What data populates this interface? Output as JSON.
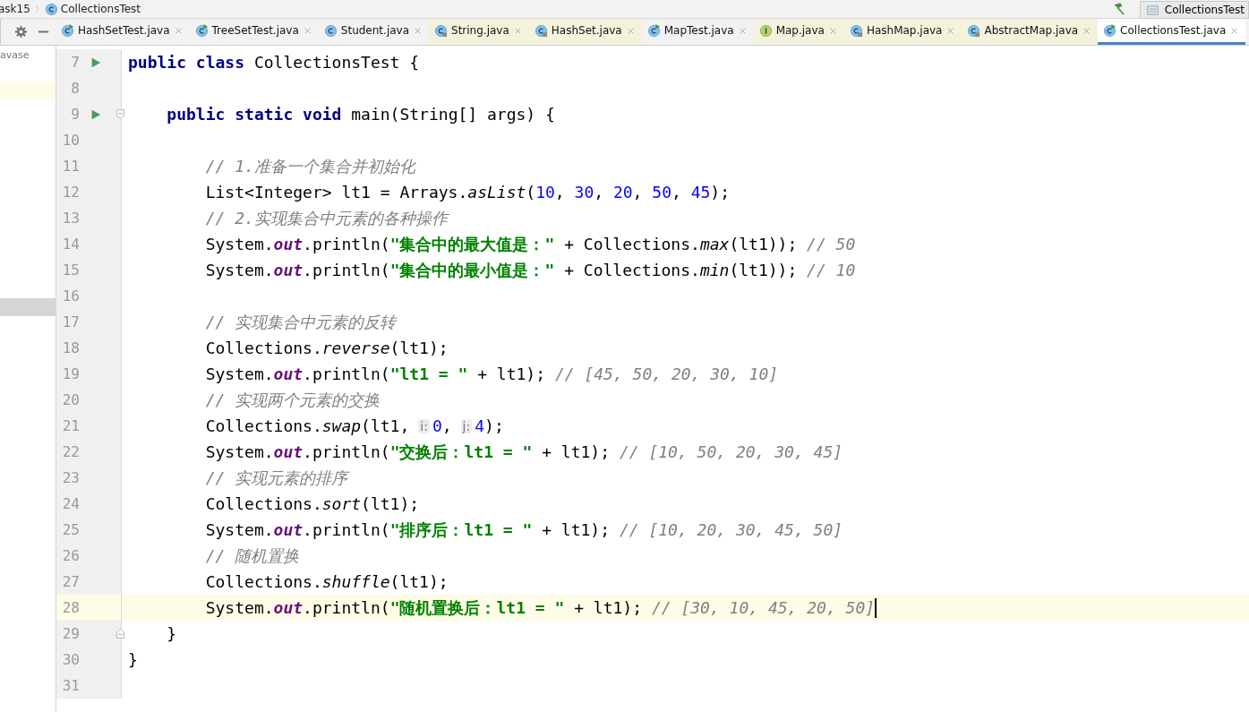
{
  "breadcrumb": [
    {
      "text": "ask15"
    },
    {
      "text": "CollectionsTest",
      "kind": "class"
    }
  ],
  "run_config": {
    "label": "CollectionsTest"
  },
  "project_panel": {
    "label": "avase",
    "rows": [
      {
        "kind": "highlight"
      },
      {
        "kind": "selected"
      }
    ]
  },
  "tabs": [
    {
      "label": "HashSetTest.java",
      "kind": "class-run",
      "readonly": false,
      "selected": false
    },
    {
      "label": "TreeSetTest.java",
      "kind": "class-run",
      "readonly": false,
      "selected": false
    },
    {
      "label": "Student.java",
      "kind": "class",
      "readonly": false,
      "selected": false
    },
    {
      "label": "String.java",
      "kind": "class-locked",
      "readonly": true,
      "selected": false
    },
    {
      "label": "HashSet.java",
      "kind": "class-locked",
      "readonly": true,
      "selected": false
    },
    {
      "label": "MapTest.java",
      "kind": "class-run",
      "readonly": false,
      "selected": false
    },
    {
      "label": "Map.java",
      "kind": "interface",
      "readonly": true,
      "selected": false
    },
    {
      "label": "HashMap.java",
      "kind": "class-locked",
      "readonly": true,
      "selected": false
    },
    {
      "label": "AbstractMap.java",
      "kind": "class-locked",
      "readonly": true,
      "selected": false
    },
    {
      "label": "CollectionsTest.java",
      "kind": "class-run",
      "readonly": false,
      "selected": true
    }
  ],
  "editor": {
    "lines": [
      {
        "number": "7",
        "run": true,
        "kind": "plain",
        "current": false,
        "tokens": [
          {
            "kind": "kw",
            "text": "public class"
          },
          {
            "kind": "plain",
            "text": " CollectionsTest {"
          }
        ]
      },
      {
        "number": "8",
        "run": false,
        "kind": "plain",
        "current": false
      },
      {
        "number": "9",
        "run": true,
        "kind": "fold-start",
        "current": false,
        "tokens": [
          {
            "kind": "kw",
            "text": "    public static void"
          },
          {
            "kind": "plain",
            "text": " main(String[] args) {"
          }
        ]
      },
      {
        "number": "10",
        "run": false,
        "kind": "plain",
        "current": false
      },
      {
        "number": "11",
        "run": false,
        "kind": "plain",
        "current": false,
        "tokens": [
          {
            "kind": "comment",
            "text": "        // 1.准备一个集合并初始化"
          }
        ]
      },
      {
        "number": "12",
        "run": false,
        "kind": "plain",
        "current": false,
        "tokens": [
          {
            "kind": "plain",
            "text": "        List<Integer> lt1 = Arrays."
          },
          {
            "kind": "method",
            "text": "asList"
          },
          {
            "kind": "plain",
            "text": "("
          },
          {
            "kind": "num",
            "text": "10"
          },
          {
            "kind": "plain",
            "text": ", "
          },
          {
            "kind": "num",
            "text": "30"
          },
          {
            "kind": "plain",
            "text": ", "
          },
          {
            "kind": "num",
            "text": "20"
          },
          {
            "kind": "plain",
            "text": ", "
          },
          {
            "kind": "num",
            "text": "50"
          },
          {
            "kind": "plain",
            "text": ", "
          },
          {
            "kind": "num",
            "text": "45"
          },
          {
            "kind": "plain",
            "text": ");"
          }
        ]
      },
      {
        "number": "13",
        "run": false,
        "kind": "plain",
        "current": false,
        "tokens": [
          {
            "kind": "comment",
            "text": "        // 2.实现集合中元素的各种操作"
          }
        ]
      },
      {
        "number": "14",
        "run": false,
        "kind": "plain",
        "current": false,
        "tokens": [
          {
            "kind": "plain",
            "text": "        System."
          },
          {
            "kind": "static",
            "text": "out"
          },
          {
            "kind": "plain",
            "text": ".println("
          },
          {
            "kind": "str",
            "text": "\"集合中的最大值是：\""
          },
          {
            "kind": "plain",
            "text": " + Collections."
          },
          {
            "kind": "method",
            "text": "max"
          },
          {
            "kind": "plain",
            "text": "(lt1)); "
          },
          {
            "kind": "comment",
            "text": "// 50"
          }
        ]
      },
      {
        "number": "15",
        "run": false,
        "kind": "plain",
        "current": false,
        "tokens": [
          {
            "kind": "plain",
            "text": "        System."
          },
          {
            "kind": "static",
            "text": "out"
          },
          {
            "kind": "plain",
            "text": ".println("
          },
          {
            "kind": "str",
            "text": "\"集合中的最小值是：\""
          },
          {
            "kind": "plain",
            "text": " + Collections."
          },
          {
            "kind": "method",
            "text": "min"
          },
          {
            "kind": "plain",
            "text": "(lt1)); "
          },
          {
            "kind": "comment",
            "text": "// 10"
          }
        ]
      },
      {
        "number": "16",
        "run": false,
        "kind": "plain",
        "current": false
      },
      {
        "number": "17",
        "run": false,
        "kind": "plain",
        "current": false,
        "tokens": [
          {
            "kind": "comment",
            "text": "        // 实现集合中元素的反转"
          }
        ]
      },
      {
        "number": "18",
        "run": false,
        "kind": "plain",
        "current": false,
        "tokens": [
          {
            "kind": "plain",
            "text": "        Collections."
          },
          {
            "kind": "method",
            "text": "reverse"
          },
          {
            "kind": "plain",
            "text": "(lt1);"
          }
        ]
      },
      {
        "number": "19",
        "run": false,
        "kind": "plain",
        "current": false,
        "tokens": [
          {
            "kind": "plain",
            "text": "        System."
          },
          {
            "kind": "static",
            "text": "out"
          },
          {
            "kind": "plain",
            "text": ".println("
          },
          {
            "kind": "str",
            "text": "\"lt1 = \""
          },
          {
            "kind": "plain",
            "text": " + lt1); "
          },
          {
            "kind": "comment",
            "text": "// [45, 50, 20, 30, 10]"
          }
        ]
      },
      {
        "number": "20",
        "run": false,
        "kind": "plain",
        "current": false,
        "tokens": [
          {
            "kind": "comment",
            "text": "        // 实现两个元素的交换"
          }
        ]
      },
      {
        "number": "21",
        "run": false,
        "kind": "plain",
        "current": false,
        "tokens": [
          {
            "kind": "plain",
            "text": "        Collections."
          },
          {
            "kind": "method",
            "text": "swap"
          },
          {
            "kind": "plain",
            "text": "(lt1,"
          },
          {
            "kind": "hint",
            "text": "i:"
          },
          {
            "kind": "num",
            "text": "0"
          },
          {
            "kind": "plain",
            "text": ","
          },
          {
            "kind": "hint",
            "text": "j:"
          },
          {
            "kind": "num",
            "text": "4"
          },
          {
            "kind": "plain",
            "text": ");"
          }
        ]
      },
      {
        "number": "22",
        "run": false,
        "kind": "plain",
        "current": false,
        "tokens": [
          {
            "kind": "plain",
            "text": "        System."
          },
          {
            "kind": "static",
            "text": "out"
          },
          {
            "kind": "plain",
            "text": ".println("
          },
          {
            "kind": "str",
            "text": "\"交换后：lt1 = \""
          },
          {
            "kind": "plain",
            "text": " + lt1); "
          },
          {
            "kind": "comment",
            "text": "// [10, 50, 20, 30, 45]"
          }
        ]
      },
      {
        "number": "23",
        "run": false,
        "kind": "plain",
        "current": false,
        "tokens": [
          {
            "kind": "comment",
            "text": "        // 实现元素的排序"
          }
        ]
      },
      {
        "number": "24",
        "run": false,
        "kind": "plain",
        "current": false,
        "tokens": [
          {
            "kind": "plain",
            "text": "        Collections."
          },
          {
            "kind": "method",
            "text": "sort"
          },
          {
            "kind": "plain",
            "text": "(lt1);"
          }
        ]
      },
      {
        "number": "25",
        "run": false,
        "kind": "plain",
        "current": false,
        "tokens": [
          {
            "kind": "plain",
            "text": "        System."
          },
          {
            "kind": "static",
            "text": "out"
          },
          {
            "kind": "plain",
            "text": ".println("
          },
          {
            "kind": "str",
            "text": "\"排序后：lt1 = \""
          },
          {
            "kind": "plain",
            "text": " + lt1); "
          },
          {
            "kind": "comment",
            "text": "// [10, 20, 30, 45, 50]"
          }
        ]
      },
      {
        "number": "26",
        "run": false,
        "kind": "plain",
        "current": false,
        "tokens": [
          {
            "kind": "comment",
            "text": "        // 随机置换"
          }
        ]
      },
      {
        "number": "27",
        "run": false,
        "kind": "plain",
        "current": false,
        "tokens": [
          {
            "kind": "plain",
            "text": "        Collections."
          },
          {
            "kind": "method",
            "text": "shuffle"
          },
          {
            "kind": "plain",
            "text": "(lt1);"
          }
        ]
      },
      {
        "number": "28",
        "run": false,
        "kind": "plain",
        "current": true,
        "tokens": [
          {
            "kind": "plain",
            "text": "        System."
          },
          {
            "kind": "static",
            "text": "out"
          },
          {
            "kind": "plain",
            "text": ".println("
          },
          {
            "kind": "str",
            "text": "\"随机置换后：lt1 = \""
          },
          {
            "kind": "plain",
            "text": " + lt1); "
          },
          {
            "kind": "comment",
            "text": "// [30, 10, 45, 20, 50]"
          }
        ]
      },
      {
        "number": "29",
        "run": false,
        "kind": "fold-end",
        "current": false,
        "tokens": [
          {
            "kind": "plain",
            "text": "    }"
          }
        ]
      },
      {
        "number": "30",
        "run": false,
        "kind": "plain",
        "current": false,
        "tokens": [
          {
            "kind": "plain",
            "text": "}"
          }
        ]
      },
      {
        "number": "31",
        "run": false,
        "kind": "plain",
        "current": false
      }
    ]
  }
}
